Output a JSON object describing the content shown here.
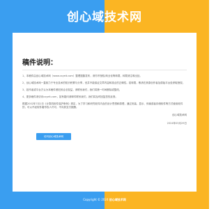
{
  "header": {
    "site_title": "创心域技术网"
  },
  "card": {
    "title": "稿件说明：",
    "items": [
      "1、本稿件由创心域技术网（www.cxyeit.com）整理搜集发布，请勿不授权/商业化等转载，转载请注明出处。",
      "2、创心域技术网一直致力于专业技术的知识积累与分享，但并不能保证文章内容和观点的正确性。若转载，敬请在其原创作者及原始平台处获取授权。",
      "3、若作者或平台方认为本稿件侵犯其合法权益，请联系我们，我们将第一时间删除或整改。",
      "4、更多稿件请访问cxyeit.com，如有疑问请邮件联系我们，我们将及时回复您的反馈。"
    ],
    "paragraph": "根据2002年7月1日《计算机软件保护条例》规定，为了学习和研究软件内含的设计思想和原理，通过安装、显示、传输或者存储软件等方式使用软件的，可以不经软件著作权人许可，不向其支付报酬。",
    "signature": "创心域技术网",
    "date": "2024年03月29日",
    "cta_label": "访问创心域技术网"
  },
  "footer": {
    "copyright": "Copyright © 2024",
    "brand": "创心域技术网"
  }
}
